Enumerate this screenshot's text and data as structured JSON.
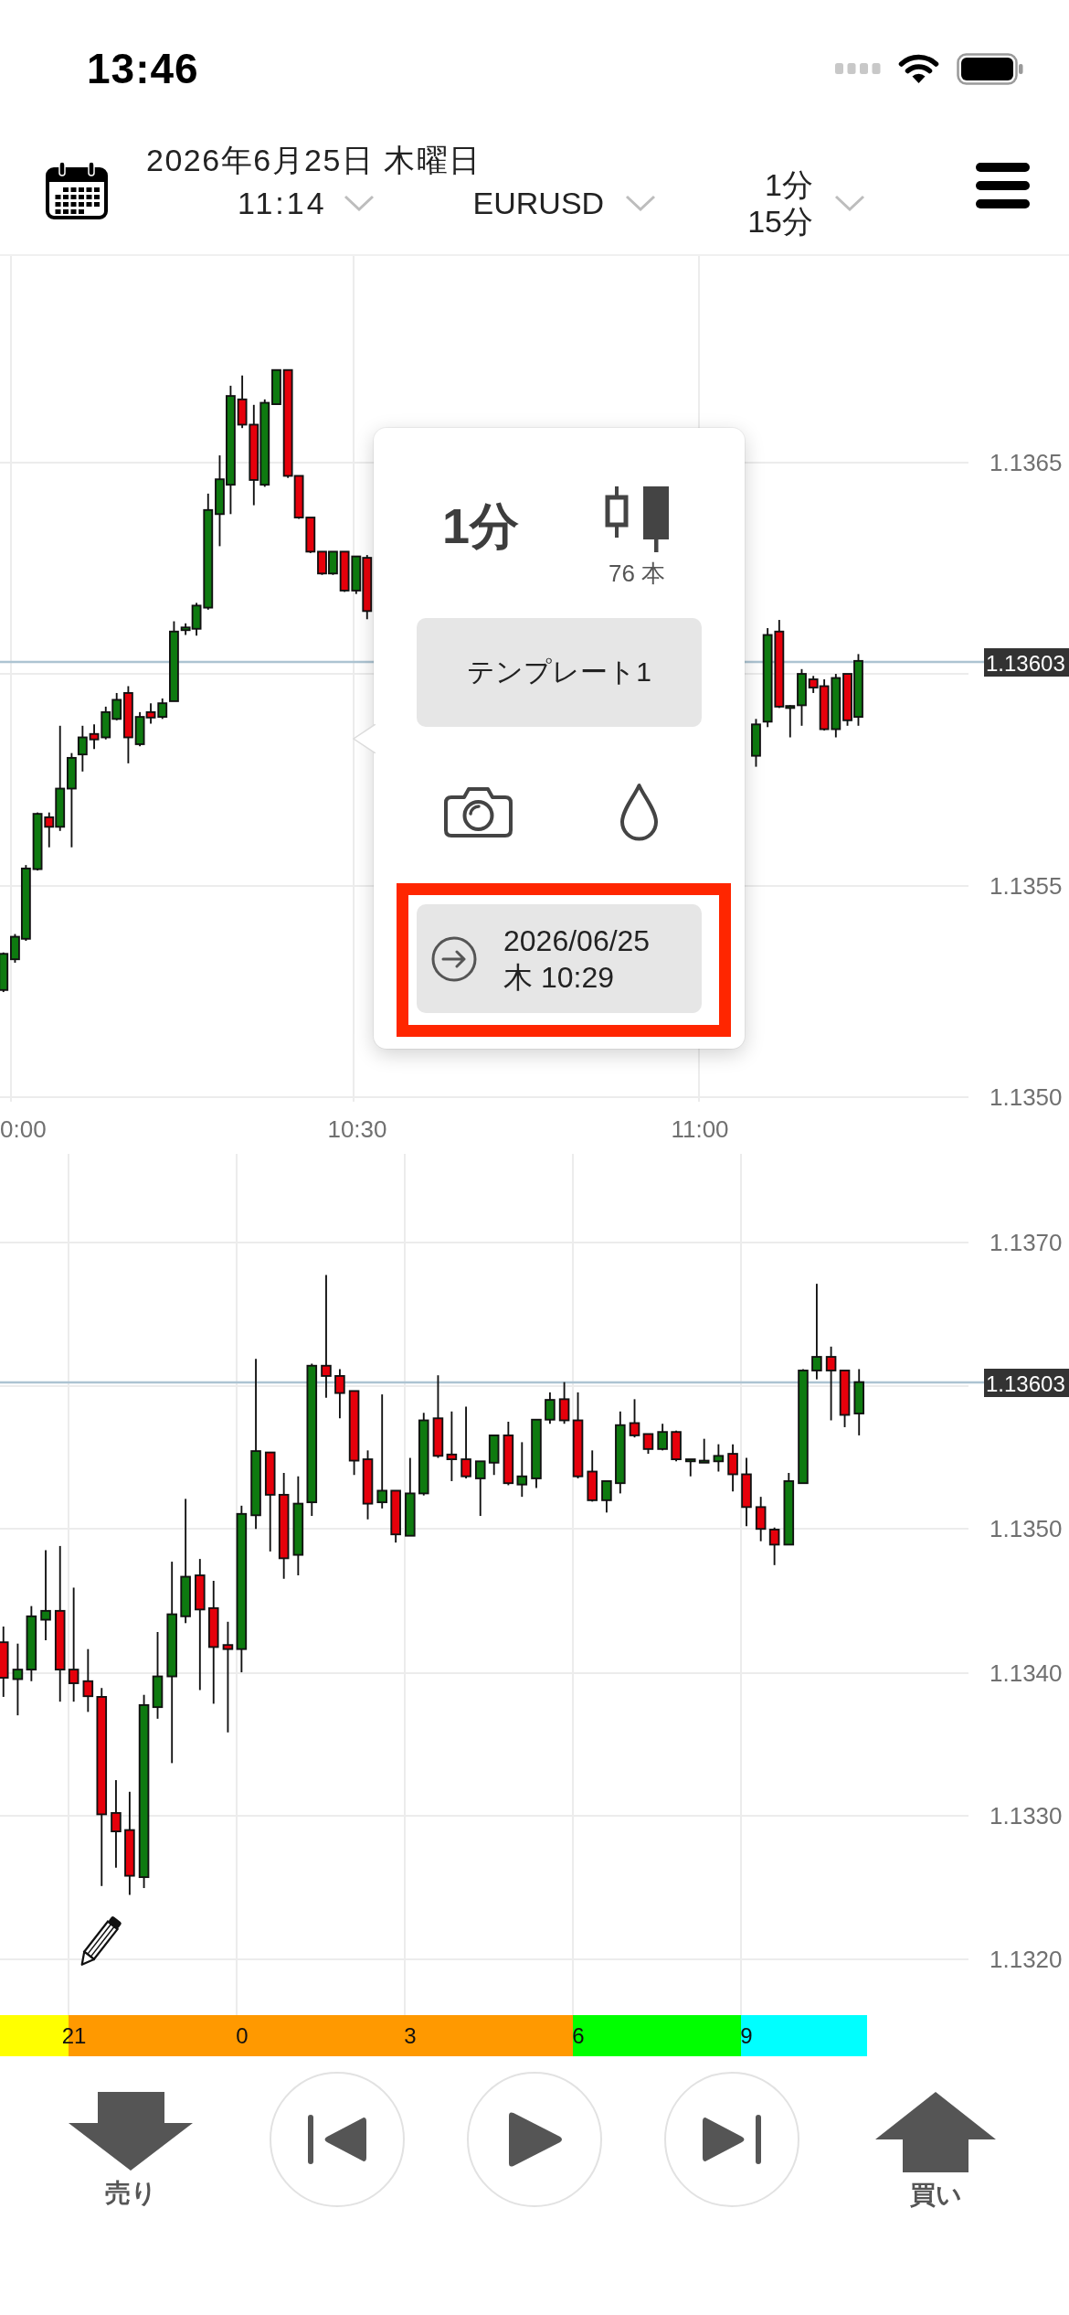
{
  "status_bar": {
    "time": "13:46"
  },
  "header": {
    "date": "2026年6月25日 木曜日",
    "time_select": "11:14",
    "symbol_select": "EURUSD",
    "timeframe_select": [
      "1分",
      "15分"
    ]
  },
  "top_chart": {
    "price_labels": [
      "1.1365",
      "1.1355",
      "1.1350"
    ],
    "current_price": "1.13603",
    "time_labels": [
      "0:00",
      "10:30",
      "11:00"
    ]
  },
  "popup": {
    "timeframe": "1分",
    "bar_count": "76 本",
    "template_button": "テンプレート1",
    "tools": [
      {
        "kind": "camera"
      },
      {
        "kind": "drop"
      }
    ],
    "jump_button": {
      "lines": [
        "2026/06/25",
        "木 10:29"
      ],
      "highlighted": true
    }
  },
  "bottom_chart": {
    "price_labels": [
      "1.1370",
      "1.1350",
      "1.1340",
      "1.1330",
      "1.1320"
    ],
    "current_price": "1.13603"
  },
  "hour_bar": {
    "segments": [
      {
        "color": "#ffff00"
      },
      {
        "color": "#ff9900",
        "labels": [
          "21",
          "0",
          "3"
        ]
      },
      {
        "color": "#00ff00",
        "labels": [
          "6"
        ]
      },
      {
        "color": "#00ffff",
        "labels": [
          "9"
        ]
      }
    ]
  },
  "bottom_bar": [
    {
      "kind": "sell",
      "label": "売り"
    },
    {
      "kind": "skip_back"
    },
    {
      "kind": "play"
    },
    {
      "kind": "skip_forward"
    },
    {
      "kind": "buy",
      "label": "買い"
    }
  ]
}
